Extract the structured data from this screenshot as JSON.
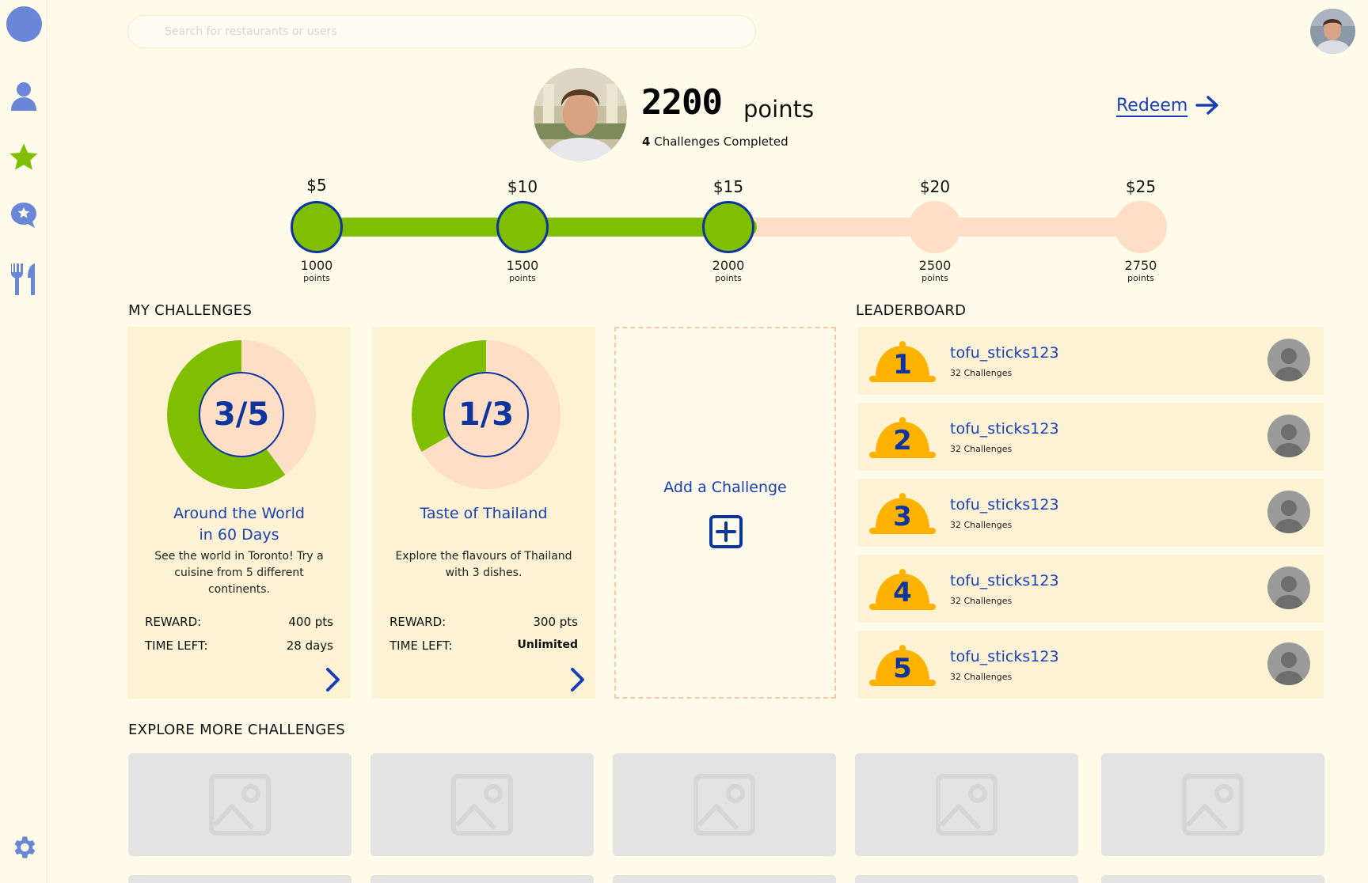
{
  "search": {
    "placeholder": "Search for restaurants or users"
  },
  "sidebar": {
    "items": [
      {
        "icon": "user-icon",
        "label": "Profile"
      },
      {
        "icon": "star-icon",
        "label": "Challenges"
      },
      {
        "icon": "star-chat-icon",
        "label": "Reviews"
      },
      {
        "icon": "utensils-icon",
        "label": "Restaurants"
      }
    ],
    "settings_icon": "gear-icon"
  },
  "profile": {
    "points": "2200",
    "points_word": "points",
    "completed_count": "4",
    "completed_label": "Challenges Completed",
    "redeem_label": "Redeem"
  },
  "progress": {
    "current_points": 2200,
    "milestones": [
      {
        "reward": "$5",
        "points": "1000",
        "unit": "points",
        "reached": true
      },
      {
        "reward": "$10",
        "points": "1500",
        "unit": "points",
        "reached": true
      },
      {
        "reward": "$15",
        "points": "2000",
        "unit": "points",
        "reached": true
      },
      {
        "reward": "$20",
        "points": "2500",
        "unit": "points",
        "reached": false
      },
      {
        "reward": "$25",
        "points": "2750",
        "unit": "points",
        "reached": false
      }
    ],
    "fill_fraction": 0.52
  },
  "my_challenges": {
    "title": "MY CHALLENGES",
    "cards": [
      {
        "progress": "3/5",
        "progress_fraction": 0.6,
        "title_line1": "Around the World",
        "title_line2": "in 60 Days",
        "description": "See the world in Toronto! Try a cuisine from 5 different continents.",
        "reward_label": "REWARD:",
        "reward_value": "400",
        "reward_unit": "pts",
        "time_label": "TIME LEFT:",
        "time_value": "28",
        "time_unit": "days"
      },
      {
        "progress": "1/3",
        "progress_fraction": 0.333,
        "title_line1": "Taste of Thailand",
        "title_line2": "",
        "description": "Explore the flavours of Thailand with 3 dishes.",
        "reward_label": "REWARD:",
        "reward_value": "300",
        "reward_unit": "pts",
        "time_label": "TIME LEFT:",
        "time_value": "Unlimited",
        "time_unit": ""
      }
    ],
    "add_label": "Add a Challenge"
  },
  "leaderboard": {
    "title": "LEADERBOARD",
    "entries": [
      {
        "rank": "1",
        "username": "tofu_sticks123",
        "challenges": "32 Challenges"
      },
      {
        "rank": "2",
        "username": "tofu_sticks123",
        "challenges": "32 Challenges"
      },
      {
        "rank": "3",
        "username": "tofu_sticks123",
        "challenges": "32 Challenges"
      },
      {
        "rank": "4",
        "username": "tofu_sticks123",
        "challenges": "32 Challenges"
      },
      {
        "rank": "5",
        "username": "tofu_sticks123",
        "challenges": "32 Challenges"
      }
    ]
  },
  "explore": {
    "title": "EXPLORE  MORE CHALLENGES",
    "tile_icon": "image-placeholder-icon"
  },
  "colors": {
    "background": "#FEFBEA",
    "accent_blue": "#1A3FB5",
    "dark_blue": "#0E34A0",
    "green": "#7FBE00",
    "peach": "#FEDEC4",
    "card": "#FEF2D5",
    "gold": "#FFB300",
    "sidebar_icon": "#6A86D6"
  }
}
